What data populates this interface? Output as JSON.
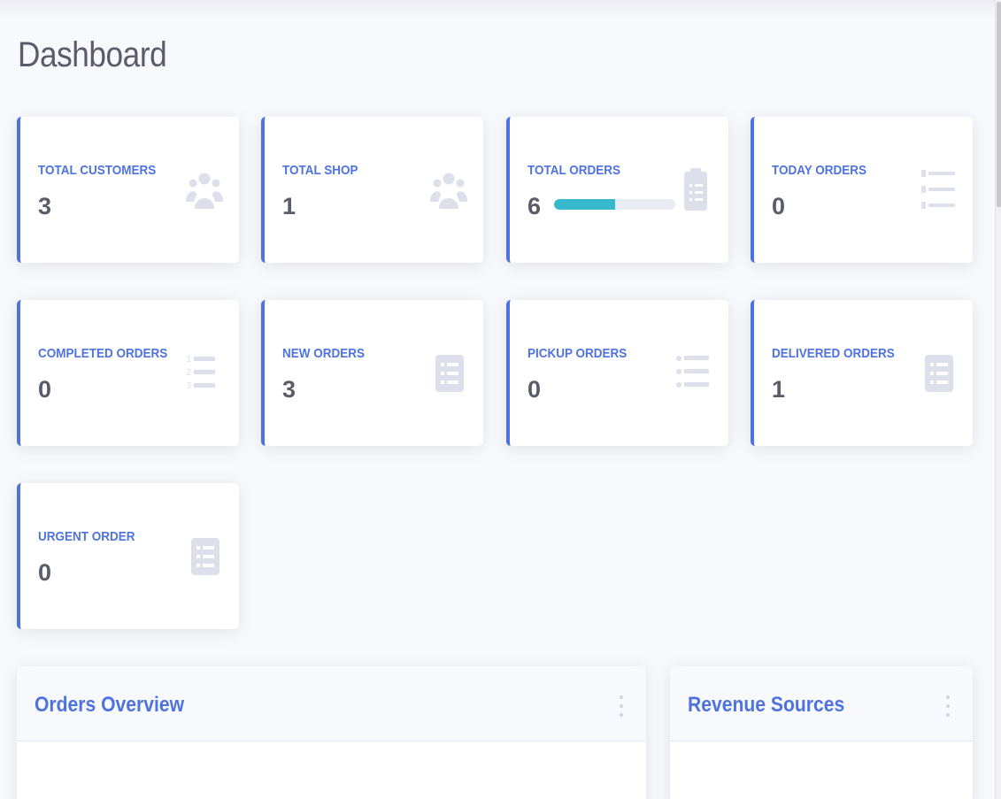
{
  "page": {
    "title": "Dashboard"
  },
  "colors": {
    "accent": "#4e73df",
    "icon": "#dddfeb",
    "progress": "#36b9cc",
    "text": "#5a5c69"
  },
  "cards": [
    {
      "label": "TOTAL CUSTOMERS",
      "value": "3",
      "icon": "users-icon"
    },
    {
      "label": "TOTAL SHOP",
      "value": "1",
      "icon": "users-icon"
    },
    {
      "label": "TOTAL ORDERS",
      "value": "6",
      "icon": "clipboard-list-icon",
      "progress": 0.5
    },
    {
      "label": "TODAY ORDERS",
      "value": "0",
      "icon": "list-icon"
    },
    {
      "label": "COMPLETED ORDERS",
      "value": "0",
      "icon": "list-ol-icon"
    },
    {
      "label": "NEW ORDERS",
      "value": "3",
      "icon": "list-alt-icon"
    },
    {
      "label": "PICKUP ORDERS",
      "value": "0",
      "icon": "list-ul-icon"
    },
    {
      "label": "DELIVERED ORDERS",
      "value": "1",
      "icon": "list-alt-icon"
    },
    {
      "label": "URGENT ORDER",
      "value": "0",
      "icon": "list-alt-icon"
    }
  ],
  "panels": [
    {
      "title": "Orders Overview",
      "icon": "more-vertical-icon"
    },
    {
      "title": "Revenue Sources",
      "icon": "more-vertical-icon"
    }
  ]
}
